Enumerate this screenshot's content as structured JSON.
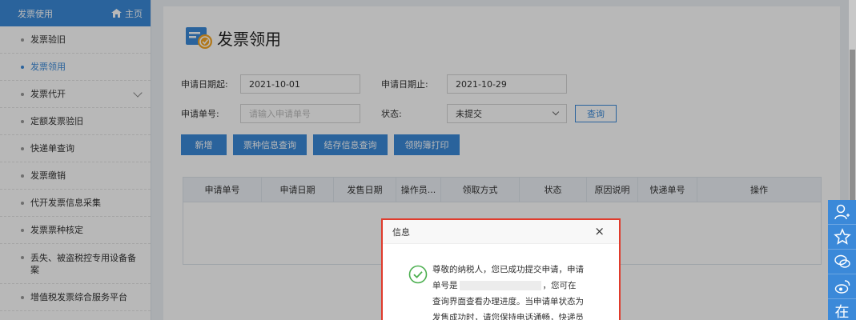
{
  "sidebar": {
    "header_title": "发票使用",
    "home_label": "主页",
    "items": [
      {
        "label": "发票验旧",
        "active": false
      },
      {
        "label": "发票领用",
        "active": true
      },
      {
        "label": "发票代开",
        "active": false,
        "expandable": true
      },
      {
        "label": "定额发票验旧",
        "active": false
      },
      {
        "label": "快递单查询",
        "active": false
      },
      {
        "label": "发票缴销",
        "active": false
      },
      {
        "label": "代开发票信息采集",
        "active": false
      },
      {
        "label": "发票票种核定",
        "active": false
      },
      {
        "label": "丢失、被盗税控专用设备备案",
        "active": false
      },
      {
        "label": "增值税发票综合服务平台",
        "active": false
      }
    ]
  },
  "page": {
    "title": "发票领用",
    "form": {
      "start_date_label": "申请日期起:",
      "start_date_value": "2021-10-01",
      "end_date_label": "申请日期止:",
      "end_date_value": "2021-10-29",
      "order_no_label": "申请单号:",
      "order_no_placeholder": "请输入申请单号",
      "status_label": "状态:",
      "status_value": "未提交",
      "query_button": "查询"
    },
    "actions": {
      "new": "新增",
      "ticket_type_query": "票种信息查询",
      "stock_query": "结存信息查询",
      "print_book": "领购簿打印"
    },
    "table": {
      "columns": [
        "申请单号",
        "申请日期",
        "发售日期",
        "操作员...",
        "领取方式",
        "状态",
        "原因说明",
        "快递单号",
        "操作"
      ]
    }
  },
  "dialog": {
    "title": "信息",
    "close": "×",
    "line1": "尊敬的纳税人，您已成功提交申请，申请",
    "line2a": "单号是",
    "line2b": "，您可在",
    "line3": "查询界面查看办理进度。当申请单状态为",
    "line4": "发售成功时，请您保持电话通畅，快递员"
  },
  "tools": {
    "online_label": "在"
  },
  "colors": {
    "accent": "#3b89d9",
    "highlight": "#e03b2c"
  }
}
